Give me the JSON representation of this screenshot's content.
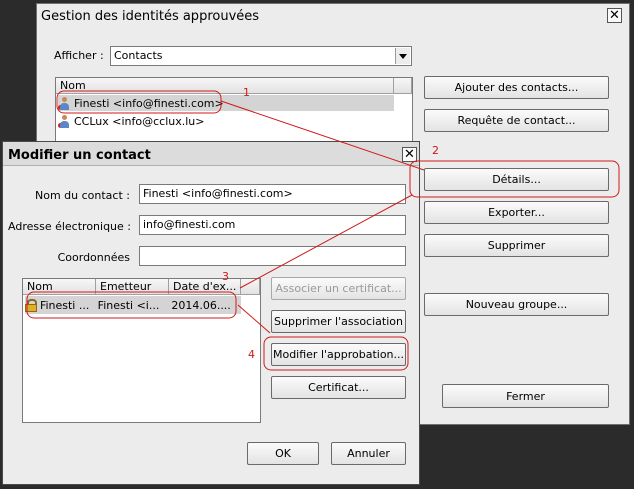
{
  "main_window": {
    "title": "Gestion des identités approuvées",
    "close_glyph": "✕",
    "show_label": "Afficher :",
    "show_value": "Contacts",
    "list_header": "Nom",
    "contacts": [
      {
        "name": "Finesti <info@finesti.com>",
        "icon": "person-icon"
      },
      {
        "name": "CCLux <info@cclux.lu>",
        "icon": "person-icon"
      }
    ],
    "buttons": {
      "add_contacts": "Ajouter des contacts...",
      "contact_request": "Requête de contact...",
      "details": "Détails...",
      "export": "Exporter...",
      "delete": "Supprimer",
      "new_group": "Nouveau groupe...",
      "close": "Fermer"
    }
  },
  "dialog": {
    "title": "Modifier un contact",
    "close_glyph": "✕",
    "contact_name_label": "Nom du contact :",
    "contact_name_value": "Finesti <info@finesti.com>",
    "email_label": "Adresse électronique :",
    "email_value": "info@finesti.com",
    "coords_label": "Coordonnées",
    "coords_value": "",
    "cert_columns": [
      "Nom",
      "Emetteur",
      "Date d'ex..."
    ],
    "cert_rows": [
      {
        "name": "Finesti ...",
        "issuer": "Finesti <i...",
        "date": "2014.06...."
      }
    ],
    "buttons": {
      "associate_cert": "Associer un certificat...",
      "remove_assoc": "Supprimer l'association",
      "modify_approval": "Modifier l'approbation...",
      "certificate": "Certificat...",
      "ok": "OK",
      "cancel": "Annuler"
    }
  },
  "annotations": {
    "step1": "1",
    "step2": "2",
    "step3": "3",
    "step4": "4",
    "color": "#d01818"
  }
}
